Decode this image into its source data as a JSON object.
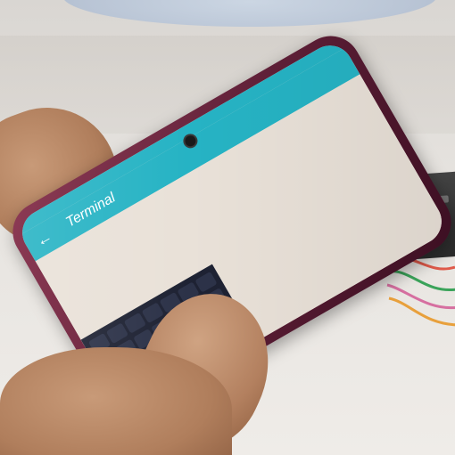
{
  "status_bar": {
    "text": ""
  },
  "app_bar": {
    "title": "Terminal",
    "back_icon": "arrow-left-icon"
  },
  "terminal": {
    "line": ""
  },
  "colors": {
    "accent": "#26b3c4",
    "screen_background": "#e9e1d8",
    "keyboard": "#1e2233",
    "phone_case": "#6b2640"
  }
}
